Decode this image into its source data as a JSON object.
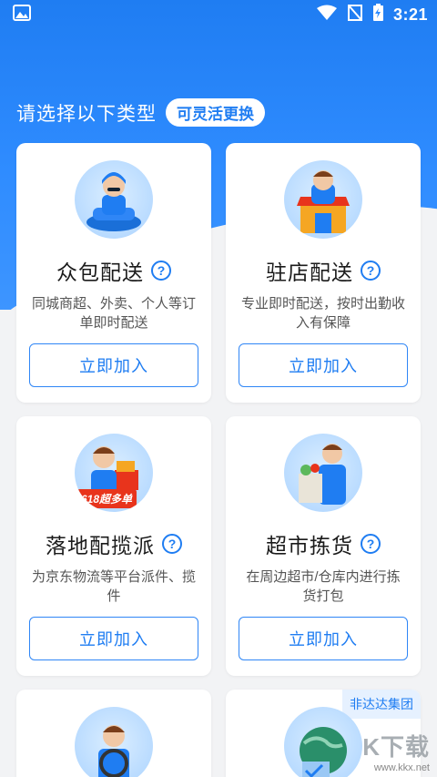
{
  "status": {
    "time": "3:21"
  },
  "intro": {
    "title": "请选择以下类型",
    "badge": "可灵活更换"
  },
  "cards": [
    {
      "title": "众包配送",
      "desc": "同城商超、外卖、个人等订单即时配送",
      "button": "立即加入",
      "help": "?"
    },
    {
      "title": "驻店配送",
      "desc": "专业即时配送，按时出勤收入有保障",
      "button": "立即加入",
      "help": "?"
    },
    {
      "title": "落地配揽派",
      "desc": "为京东物流等平台派件、揽件",
      "button": "立即加入",
      "help": "?",
      "promo": "618超多单"
    },
    {
      "title": "超市拣货",
      "desc": "在周边超市/仓库内进行拣货打包",
      "button": "立即加入",
      "help": "?"
    }
  ],
  "partial_cards": [
    {
      "badge": ""
    },
    {
      "badge": "非达达集团"
    }
  ],
  "watermark": {
    "text": "K下载",
    "url": "www.kkx.net"
  },
  "colors": {
    "primary": "#1f7df2",
    "background": "#f2f3f5",
    "promo": "#e8341c"
  }
}
